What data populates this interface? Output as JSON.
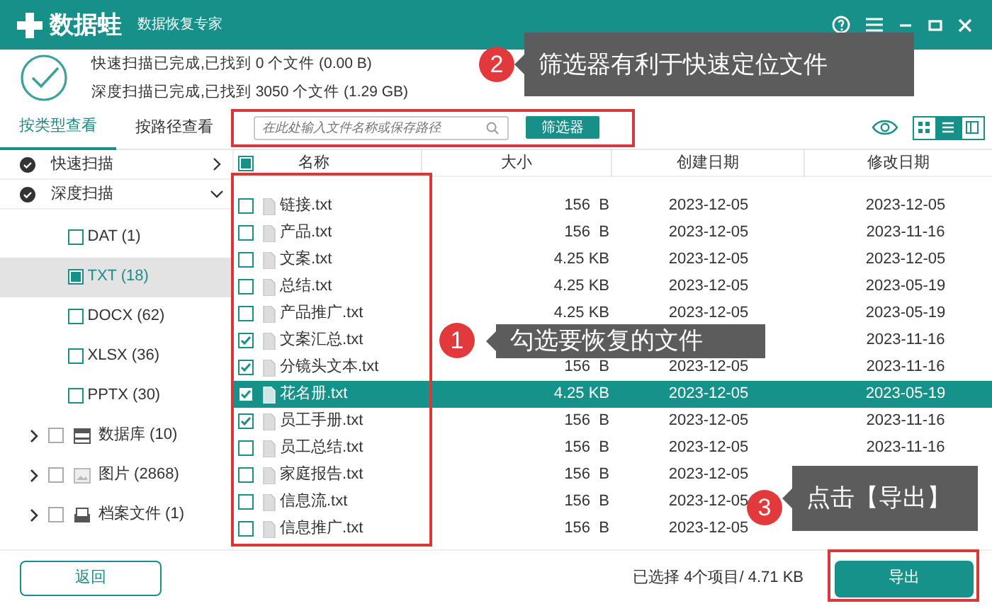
{
  "window": {
    "app_name": "数据蛙",
    "subtitle": "数据恢复专家"
  },
  "scan_summary": [
    "快速扫描已完成,已找到 0 个文件 (0.00  B)",
    "深度扫描已完成,已找到 3050 个文件 (1.29 GB)"
  ],
  "view_tabs": [
    {
      "label": "按类型查看",
      "selected": true
    },
    {
      "label": "按路径查看",
      "selected": false
    }
  ],
  "search": {
    "placeholder": "在此处输入文件名称或保存路径"
  },
  "filter_button": "筛选器",
  "view_modes": [
    {
      "kind": "grid",
      "selected": false
    },
    {
      "kind": "list",
      "selected": true
    },
    {
      "kind": "columns",
      "selected": false
    }
  ],
  "sidebar": [
    {
      "label": "快速扫描",
      "expanded": false
    },
    {
      "label": "深度扫描",
      "expanded": true,
      "children": [
        {
          "kind": "filetype",
          "label": "DAT (1)",
          "checked": false,
          "partial": false,
          "selected": false
        },
        {
          "kind": "filetype",
          "label": "TXT (18)",
          "checked": false,
          "partial": true,
          "selected": true
        },
        {
          "kind": "filetype",
          "label": "DOCX (62)",
          "checked": false,
          "partial": false,
          "selected": false
        },
        {
          "kind": "filetype",
          "label": "XLSX (36)",
          "checked": false,
          "partial": false,
          "selected": false
        },
        {
          "kind": "filetype",
          "label": "PPTX (30)",
          "checked": false,
          "partial": false,
          "selected": false
        },
        {
          "kind": "database",
          "label": "数据库 (10)",
          "checked": false,
          "partial": false,
          "selected": false
        },
        {
          "kind": "images",
          "label": "图片 (2868)",
          "checked": false,
          "partial": false,
          "selected": false
        },
        {
          "kind": "archive",
          "label": "档案文件 (1)",
          "checked": false,
          "partial": false,
          "selected": false
        }
      ]
    }
  ],
  "table": {
    "select_all_partial": true,
    "columns": [
      "名称",
      "大小",
      "创建日期",
      "修改日期"
    ],
    "rows": [
      {
        "name": "链接.txt",
        "size": "156  B",
        "created": "2023-12-05",
        "modified": "2023-12-05",
        "checked": false,
        "selected": false
      },
      {
        "name": "产品.txt",
        "size": "156  B",
        "created": "2023-12-05",
        "modified": "2023-11-16",
        "checked": false,
        "selected": false
      },
      {
        "name": "文案.txt",
        "size": "4.25 KB",
        "created": "2023-12-05",
        "modified": "2023-12-05",
        "checked": false,
        "selected": false
      },
      {
        "name": "总结.txt",
        "size": "4.25 KB",
        "created": "2023-12-05",
        "modified": "2023-05-19",
        "checked": false,
        "selected": false
      },
      {
        "name": "产品推广.txt",
        "size": "4.25 KB",
        "created": "2023-12-05",
        "modified": "2023-05-19",
        "checked": false,
        "selected": false
      },
      {
        "name": "文案汇总.txt",
        "modified": "2023-11-16",
        "checked": true,
        "selected": false
      },
      {
        "name": "分镜头文本.txt",
        "size": "156  B",
        "created": "2023-12-05",
        "modified": "2023-11-16",
        "checked": true,
        "selected": false
      },
      {
        "name": "花名册.txt",
        "size": "4.25 KB",
        "created": "2023-12-05",
        "modified": "2023-05-19",
        "checked": true,
        "selected": true
      },
      {
        "name": "员工手册.txt",
        "size": "156  B",
        "created": "2023-12-05",
        "modified": "2023-11-16",
        "checked": true,
        "selected": false
      },
      {
        "name": "员工总结.txt",
        "size": "156  B",
        "created": "2023-12-05",
        "modified": "2023-11-16",
        "checked": false,
        "selected": false
      },
      {
        "name": "家庭报告.txt",
        "size": "156  B",
        "created": "2023-12-05",
        "checked": false,
        "selected": false
      },
      {
        "name": "信息流.txt",
        "size": "156  B",
        "created": "2023-12-05",
        "checked": false,
        "selected": false
      },
      {
        "name": "信息推广.txt",
        "size": "156  B",
        "created": "2023-12-05",
        "checked": false,
        "selected": false
      }
    ]
  },
  "footer": {
    "back_button": "返回",
    "selection_info": "已选择 4个项目/ 4.71 KB",
    "export_button": "导出"
  },
  "annotations": [
    {
      "number": "2",
      "text": "筛选器有利于快速定位文件"
    },
    {
      "number": "1",
      "text": "勾选要恢复的文件"
    },
    {
      "number": "3",
      "text": "点击【导出】"
    }
  ]
}
